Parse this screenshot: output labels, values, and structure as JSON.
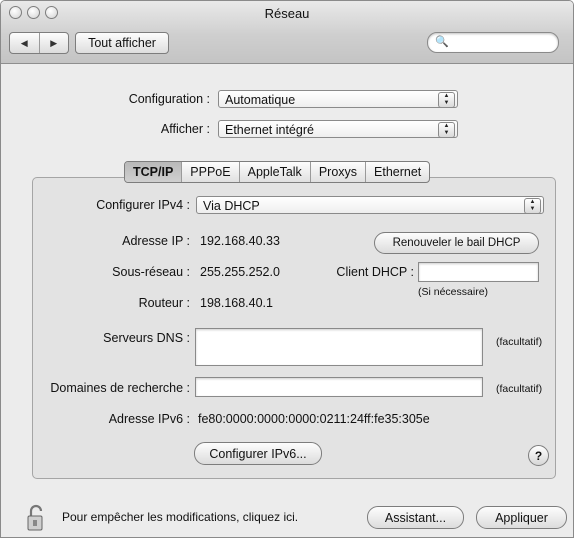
{
  "window": {
    "title": "Réseau"
  },
  "toolbar": {
    "back_icon": "◀",
    "forward_icon": "▶",
    "show_all": "Tout afficher",
    "search_icon": "🔍"
  },
  "settings": {
    "configuration_label": "Configuration :",
    "configuration_value": "Automatique",
    "show_label": "Afficher :",
    "show_value": "Ethernet intégré"
  },
  "tabs": [
    "TCP/IP",
    "PPPoE",
    "AppleTalk",
    "Proxys",
    "Ethernet"
  ],
  "tcpip": {
    "configure_ipv4_label": "Configurer IPv4 :",
    "configure_ipv4_value": "Via DHCP",
    "ip_label": "Adresse IP :",
    "ip_value": "192.168.40.33",
    "renew_button": "Renouveler le bail DHCP",
    "subnet_label": "Sous-réseau :",
    "subnet_value": "255.255.252.0",
    "dhcp_client_label": "Client DHCP :",
    "dhcp_client_value": "",
    "if_needed": "(Si nécessaire)",
    "router_label": "Routeur :",
    "router_value": "198.168.40.1",
    "dns_label": "Serveurs DNS :",
    "dns_value": "",
    "optional_dns": "(facultatif)",
    "search_domains_label": "Domaines de recherche :",
    "search_domains_value": "",
    "optional_search": "(facultatif)",
    "ipv6_label": "Adresse IPv6 :",
    "ipv6_value": "fe80:0000:0000:0000:0211:24ff:fe35:305e",
    "configure_ipv6_button": "Configurer IPv6...",
    "help": "?"
  },
  "footer": {
    "lock_text": "Pour empêcher les modifications, cliquez ici.",
    "assistant_button": "Assistant...",
    "apply_button": "Appliquer"
  }
}
